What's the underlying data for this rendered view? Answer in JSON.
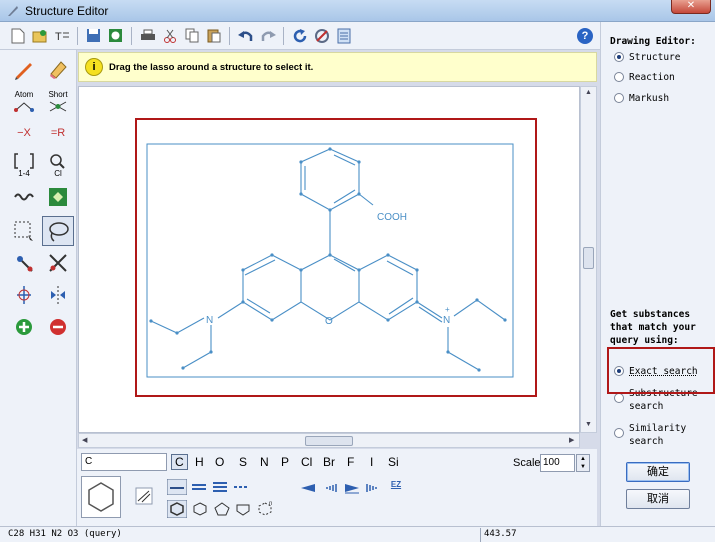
{
  "window": {
    "title": "Structure Editor",
    "close_label": "✕"
  },
  "toolbar": {
    "icons": [
      "new-icon",
      "open-icon",
      "text-icon",
      "save-icon",
      "save-image-icon",
      "print-icon",
      "cut-icon",
      "copy-icon",
      "paste-icon",
      "undo-icon",
      "redo-icon",
      "refresh-icon",
      "clear-icon",
      "document-icon"
    ],
    "help_label": "?"
  },
  "left_tools": {
    "atom_label": "Atom",
    "short_label": "Short",
    "remove_x_label": "−X",
    "replace_r_label": "=R",
    "bracket_label": "1-4",
    "charge_label": "Cl"
  },
  "hint": {
    "icon": "i",
    "text": "Drag the lasso around a structure to select it."
  },
  "molecule": {
    "substituent_label": "COOH",
    "nitrogen_label": "N",
    "oxygen_label": "O",
    "charge_label": "+"
  },
  "bottom": {
    "element_input": "C",
    "elements": [
      "C",
      "H",
      "O",
      "S",
      "N",
      "P",
      "Cl",
      "Br",
      "F",
      "I",
      "Si"
    ],
    "scale_label": "Scale",
    "scale_value": "100",
    "ez_label": "EZ"
  },
  "right_panel": {
    "drawing_heading": "Drawing Editor:",
    "drawing_options": [
      {
        "label": "Structure",
        "selected": true
      },
      {
        "label": "Reaction",
        "selected": false
      },
      {
        "label": "Markush",
        "selected": false
      }
    ],
    "query_heading": "Get substances that match your query using:",
    "search_options": [
      {
        "label": "Exact search",
        "selected": true
      },
      {
        "label": "Substructure search",
        "selected": false
      },
      {
        "label": "Similarity search",
        "selected": false
      }
    ],
    "ok_button": "确定",
    "cancel_button": "取消"
  },
  "status": {
    "formula": "C28 H31 N2 O3 (query)",
    "mass": "443.57"
  },
  "colors": {
    "bond": "#4a8fc6",
    "selection_frame": "#b01818",
    "hint_bg": "#ffffcc"
  }
}
